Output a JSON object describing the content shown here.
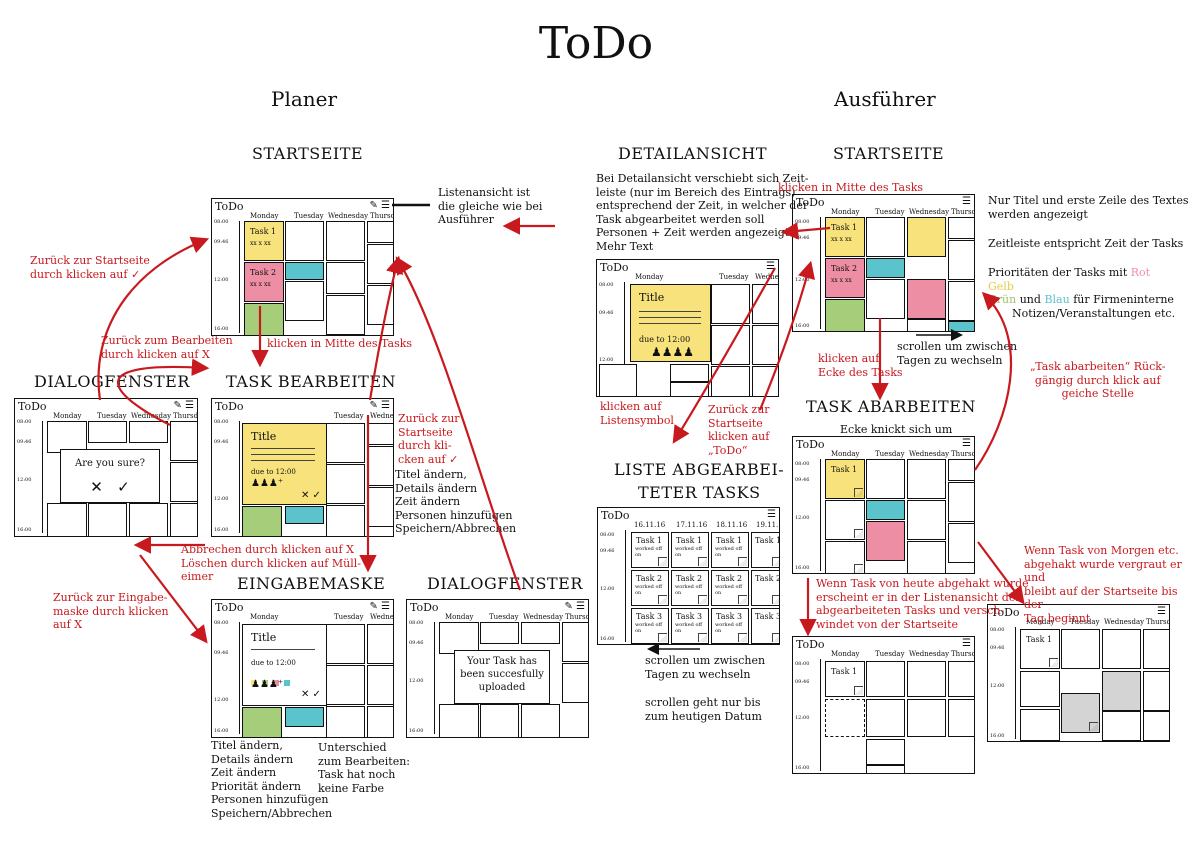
{
  "title": "ToDo",
  "columns": {
    "left": "Planer",
    "right": "Ausführer"
  },
  "sections": {
    "planer_start": "STARTSEITE",
    "task_edit": "TASK BEARBEITEN",
    "dialog1": "DIALOGFENSTER",
    "input_mask": "EINGABEMASKE",
    "dialog2": "DIALOGFENSTER",
    "detail": "DETAILANSICHT",
    "exec_start": "STARTSEITE",
    "list_done_1": "LISTE ABGEARBEI-",
    "list_done_2": "TETER TASKS",
    "task_process": "TASK ABARBEITEN"
  },
  "screen": {
    "app_title": "ToDo",
    "days": [
      "Monday",
      "Tuesday",
      "Wednesday",
      "Thursd"
    ],
    "times": [
      "08:00",
      "09:46",
      "12:00",
      "16:00"
    ],
    "task1": "Task 1",
    "task2": "Task 2",
    "task3": "Task 3",
    "sub": "xx x xx",
    "title": "Title",
    "due": "due to 12:00",
    "confirm": "Are you sure?",
    "uploaded_1": "Your Task has",
    "uploaded_2": "been succesfully",
    "uploaded_3": "uploaded",
    "list_dates": [
      "16.11.16",
      "17.11.16",
      "18.11.16",
      "19.11.1"
    ],
    "worked_off": "worked off on",
    "corner_note": "Ecke knickt sich um"
  },
  "notes": {
    "list_view": [
      "Listenansicht ist",
      "die gleiche wie bei",
      "Ausführer"
    ],
    "edit_list": [
      "Titel ändern,",
      "Details ändern",
      "Zeit ändern",
      "Personen hinzufügen",
      "Speichern/Abbrechen"
    ],
    "input_list": [
      "Titel ändern,",
      "Details ändern",
      "Zeit ändern",
      "Priorität ändern",
      "Personen hinzufügen",
      "Speichern/Abbrechen"
    ],
    "difference": [
      "Unterschied",
      "zum Bearbeiten:",
      "Task hat noch",
      "keine Farbe"
    ],
    "detail_desc": [
      "Bei Detailansicht verschiebt sich Zeit-",
      "leiste (nur im Bereich des Eintrags)",
      "entsprechend der Zeit, in welcher der",
      "Task abgearbeitet werden soll",
      "Personen + Zeit werden angezeigt",
      "Mehr Text"
    ],
    "exec_desc1": [
      "Nur Titel und erste Zeile des Textes",
      "werden angezeigt"
    ],
    "exec_desc2": "Zeitleiste entspricht Zeit der Tasks",
    "prio_1": "Prioritäten der Tasks mit",
    "prio_rot": "Rot",
    "prio_gelb": "Gelb",
    "prio_gruen": "Grün",
    "prio_und": "und",
    "prio_blau": "Blau",
    "prio_2": "für Firmeninterne",
    "prio_3": "Notizen/Veranstaltungen etc.",
    "scroll_exec": [
      "scrollen um zwischen",
      "Tagen zu wechseln"
    ],
    "scroll_list": [
      "scrollen um zwischen",
      "Tagen zu wechseln"
    ],
    "scroll_limit": [
      "scrollen geht nur bis",
      "zum heutigen Datum"
    ]
  },
  "red_notes": {
    "back_start": [
      "Zurück zur Startseite",
      "durch klicken auf ✓"
    ],
    "back_edit": [
      "Zurück zum Bearbeiten",
      "durch klicken auf X"
    ],
    "click_center": "klicken in Mitte des Tasks",
    "back_start2": [
      "Zurück zur",
      "Startseite",
      "durch kli-",
      "cken auf ✓"
    ],
    "cancel": [
      "Abbrechen durch klicken auf X",
      "Löschen durch klicken auf Müll-",
      "eimer"
    ],
    "back_input": [
      "Zurück zur Eingabe-",
      "maske durch klicken",
      "auf X"
    ],
    "click_center2": "klicken in Mitte des Tasks",
    "click_list": [
      "klicken auf",
      "Listensymbol"
    ],
    "back_todo": [
      "Zurück zur",
      "Startseite",
      "klicken auf",
      "„ToDo“"
    ],
    "click_corner": [
      "klicken auf",
      "Ecke des Tasks"
    ],
    "undo": [
      "„Task abarbeiten“ Rück-",
      "gängig durch klick auf",
      "geiche Stelle"
    ],
    "today_done": [
      "Wenn Task von heute abgehakt wurde",
      "erscheint er in der Listenansicht der",
      "abgearbeiteten Tasks und versch-",
      "windet von der Startseite"
    ],
    "tomorrow_done": [
      "Wenn Task von Morgen etc.",
      "abgehakt wurde vergraut er und",
      "bleibt auf der Startseite bis der",
      "Tag beginnt"
    ]
  },
  "colors": {
    "yellow": "#f7e27b",
    "pink": "#ee8ea4",
    "cyan": "#5bc3cc",
    "green": "#a6cd79",
    "red": "#c8191e"
  }
}
